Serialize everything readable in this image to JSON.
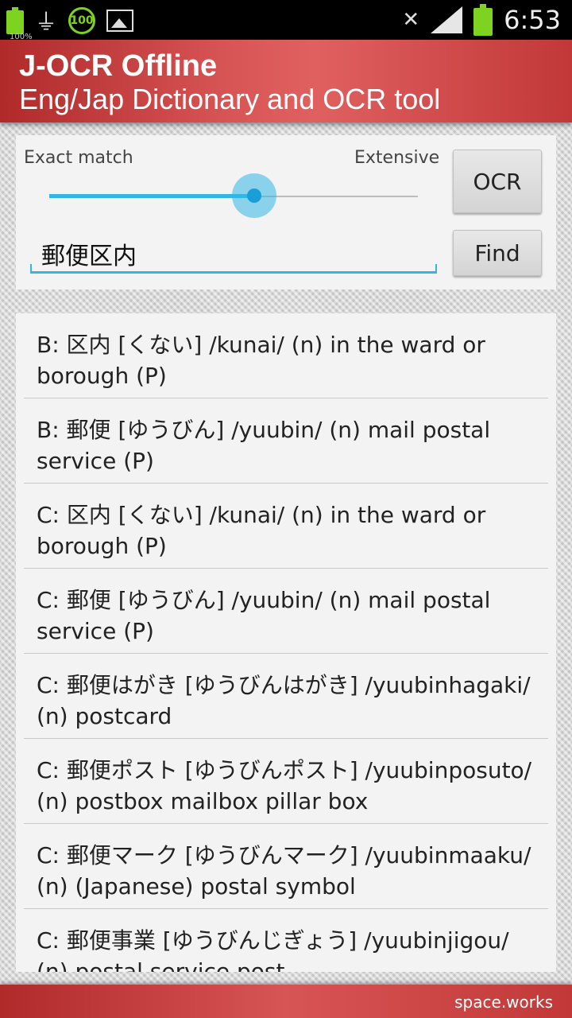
{
  "status_bar": {
    "battery_small_label": "100%",
    "badge_value": "100",
    "time": "6:53",
    "icons": [
      "battery-icon",
      "usb-icon",
      "app-100-icon",
      "image-icon",
      "mute-icon",
      "signal-icon",
      "battery-icon"
    ]
  },
  "header": {
    "title": "J-OCR Offline",
    "subtitle": "Eng/Jap Dictionary and OCR tool"
  },
  "search": {
    "slider_label_left": "Exact match",
    "slider_label_right": "Extensive",
    "slider_value": 0.55,
    "ocr_label": "OCR",
    "find_label": "Find",
    "query": "郵便区内"
  },
  "results": [
    "B: 区内 [くない] /kunai/ (n) in the ward or borough (P)",
    "B: 郵便 [ゆうびん] /yuubin/ (n) mail postal service (P)",
    "C: 区内 [くない] /kunai/ (n) in the ward or borough (P)",
    "C: 郵便 [ゆうびん] /yuubin/ (n) mail postal service (P)",
    "C: 郵便はがき [ゆうびんはがき] /yuubinhagaki/ (n) postcard",
    "C: 郵便ポスト [ゆうびんポスト] /yuubinposuto/ (n) postbox mailbox pillar box",
    "C: 郵便マーク [ゆうびんマーク] /yuubinmaaku/ (n) (Japanese) postal symbol",
    "C: 郵便事業 [ゆうびんじぎょう] /yuubinjigou/ (n) postal service post"
  ],
  "footer": {
    "brand": "space.works"
  },
  "colors": {
    "accent": "#33b5e5",
    "header_red": "#d85555",
    "status_green": "#7ed321"
  }
}
